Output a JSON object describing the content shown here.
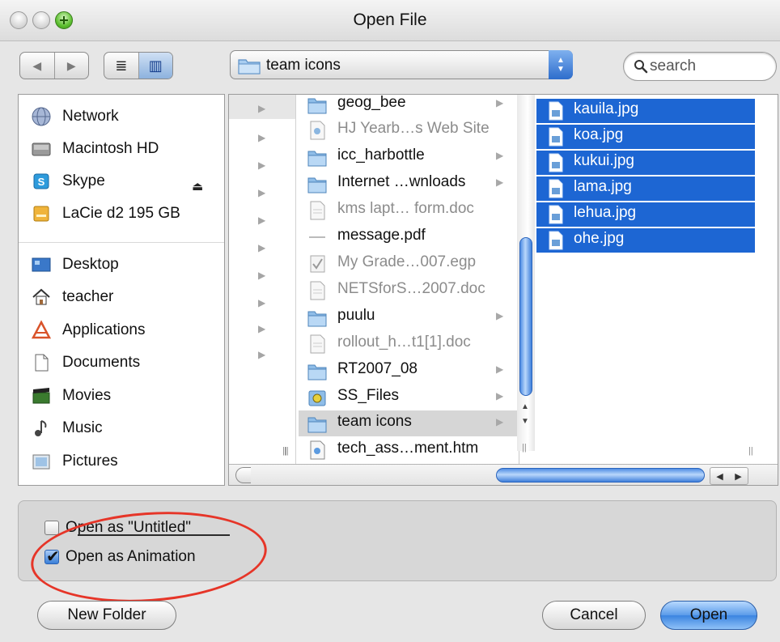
{
  "window": {
    "title": "Open File"
  },
  "toolbar": {
    "nav_back": "◀",
    "nav_forward": "▶",
    "view_list": "≣",
    "view_columns": "▥",
    "location": "team icons",
    "search_placeholder": "search"
  },
  "sidebar": {
    "devices": [
      {
        "label": "Network",
        "icon": "network-icon"
      },
      {
        "label": "Macintosh HD",
        "icon": "hard-drive-icon"
      },
      {
        "label": "Skype",
        "icon": "skype-icon",
        "eject": "⏏"
      },
      {
        "label": "LaCie d2 195 GB",
        "icon": "external-drive-icon"
      }
    ],
    "places": [
      {
        "label": "Desktop",
        "icon": "desktop-icon"
      },
      {
        "label": "teacher",
        "icon": "home-icon"
      },
      {
        "label": "Applications",
        "icon": "applications-icon"
      },
      {
        "label": "Documents",
        "icon": "documents-icon"
      },
      {
        "label": "Movies",
        "icon": "movies-icon"
      },
      {
        "label": "Music",
        "icon": "music-icon"
      },
      {
        "label": "Pictures",
        "icon": "pictures-icon"
      }
    ]
  },
  "browser": {
    "column2": [
      {
        "name": "geog_bee",
        "kind": "folder",
        "dim": false,
        "arrow": true
      },
      {
        "name": "HJ Yearb…s Web Site",
        "kind": "web",
        "dim": true,
        "arrow": false
      },
      {
        "name": "icc_harbottle",
        "kind": "folder",
        "dim": false,
        "arrow": true
      },
      {
        "name": "Internet …wnloads",
        "kind": "folder",
        "dim": false,
        "arrow": true
      },
      {
        "name": "kms lapt… form.doc",
        "kind": "doc",
        "dim": true,
        "arrow": false
      },
      {
        "name": "message.pdf",
        "kind": "pdf",
        "dim": false,
        "arrow": false
      },
      {
        "name": "My Grade…007.egp",
        "kind": "doc",
        "dim": true,
        "arrow": false
      },
      {
        "name": "NETSforS…2007.doc",
        "kind": "doc",
        "dim": true,
        "arrow": false
      },
      {
        "name": "puulu",
        "kind": "folder",
        "dim": false,
        "arrow": true
      },
      {
        "name": "rollout_h…t1[1].doc",
        "kind": "doc",
        "dim": true,
        "arrow": false
      },
      {
        "name": "RT2007_08",
        "kind": "folder",
        "dim": false,
        "arrow": true
      },
      {
        "name": "SS_Files",
        "kind": "folder-special",
        "dim": false,
        "arrow": true
      },
      {
        "name": "team icons",
        "kind": "folder",
        "dim": false,
        "arrow": true,
        "selected": true
      },
      {
        "name": "tech_ass…ment.htm",
        "kind": "web",
        "dim": false,
        "arrow": false
      }
    ],
    "column3": [
      {
        "name": "kauila.jpg"
      },
      {
        "name": "koa.jpg"
      },
      {
        "name": "kukui.jpg"
      },
      {
        "name": "lama.jpg"
      },
      {
        "name": "lehua.jpg"
      },
      {
        "name": "ohe.jpg"
      }
    ],
    "scroll_arrows": {
      "left": "◀",
      "right": "▶",
      "up": "▲",
      "down": "▼"
    }
  },
  "options": {
    "open_untitled": {
      "label": "Open as \"Untitled\"",
      "checked": false
    },
    "open_animation": {
      "label": "Open as Animation",
      "checked": true
    }
  },
  "buttons": {
    "new_folder": "New Folder",
    "cancel": "Cancel",
    "open": "Open"
  },
  "colors": {
    "selection": "#1d66d3",
    "annotation": "#e63528",
    "accent": "#3a84e0"
  }
}
